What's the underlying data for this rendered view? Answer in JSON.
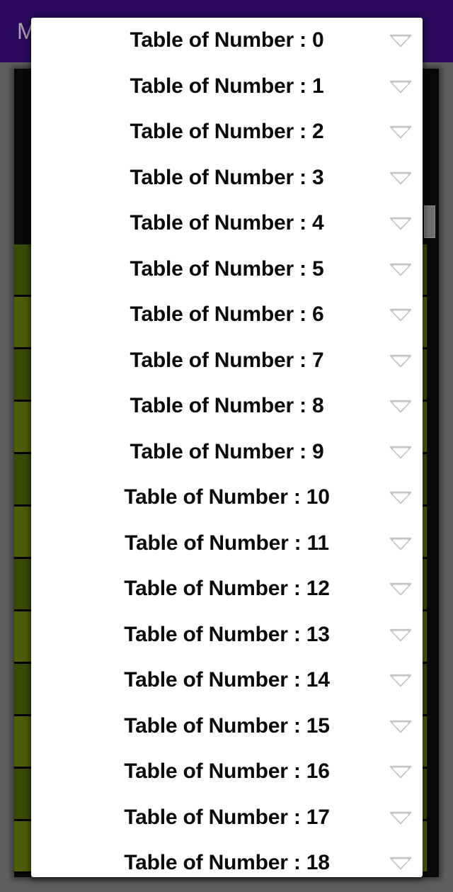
{
  "app": {
    "title": "M",
    "appbar_color": "#2b0a5e",
    "page_background": "#5e5e5e",
    "content_background": "#090909"
  },
  "background_list": {
    "row_colors": [
      "#3a4a06",
      "#4c5d08"
    ],
    "divider_color": "#000000",
    "speaker_icon": "speaker-icon",
    "items": [
      {
        "label": ""
      },
      {
        "label": ""
      },
      {
        "label": ""
      },
      {
        "label": ""
      },
      {
        "label": ""
      },
      {
        "label": ""
      },
      {
        "label": ""
      },
      {
        "label": ""
      },
      {
        "label": ""
      },
      {
        "label": ""
      },
      {
        "label": ""
      },
      {
        "label": ""
      }
    ]
  },
  "scrollbar": {
    "thumb_color": "#6f6f6f",
    "icon": "scrollbar-thumb"
  },
  "dropdown": {
    "panel_color": "#ffffff",
    "caret_icon": "chevron-down-icon",
    "items": [
      {
        "label": "Table of Number : 0"
      },
      {
        "label": "Table of Number : 1"
      },
      {
        "label": "Table of Number : 2"
      },
      {
        "label": "Table of Number : 3"
      },
      {
        "label": "Table of Number : 4"
      },
      {
        "label": "Table of Number : 5"
      },
      {
        "label": "Table of Number : 6"
      },
      {
        "label": "Table of Number : 7"
      },
      {
        "label": "Table of Number : 8"
      },
      {
        "label": "Table of Number : 9"
      },
      {
        "label": "Table of Number : 10"
      },
      {
        "label": "Table of Number : 11"
      },
      {
        "label": "Table of Number : 12"
      },
      {
        "label": "Table of Number : 13"
      },
      {
        "label": "Table of Number : 14"
      },
      {
        "label": "Table of Number : 15"
      },
      {
        "label": "Table of Number : 16"
      },
      {
        "label": "Table of Number : 17"
      },
      {
        "label": "Table of Number : 18"
      }
    ]
  }
}
